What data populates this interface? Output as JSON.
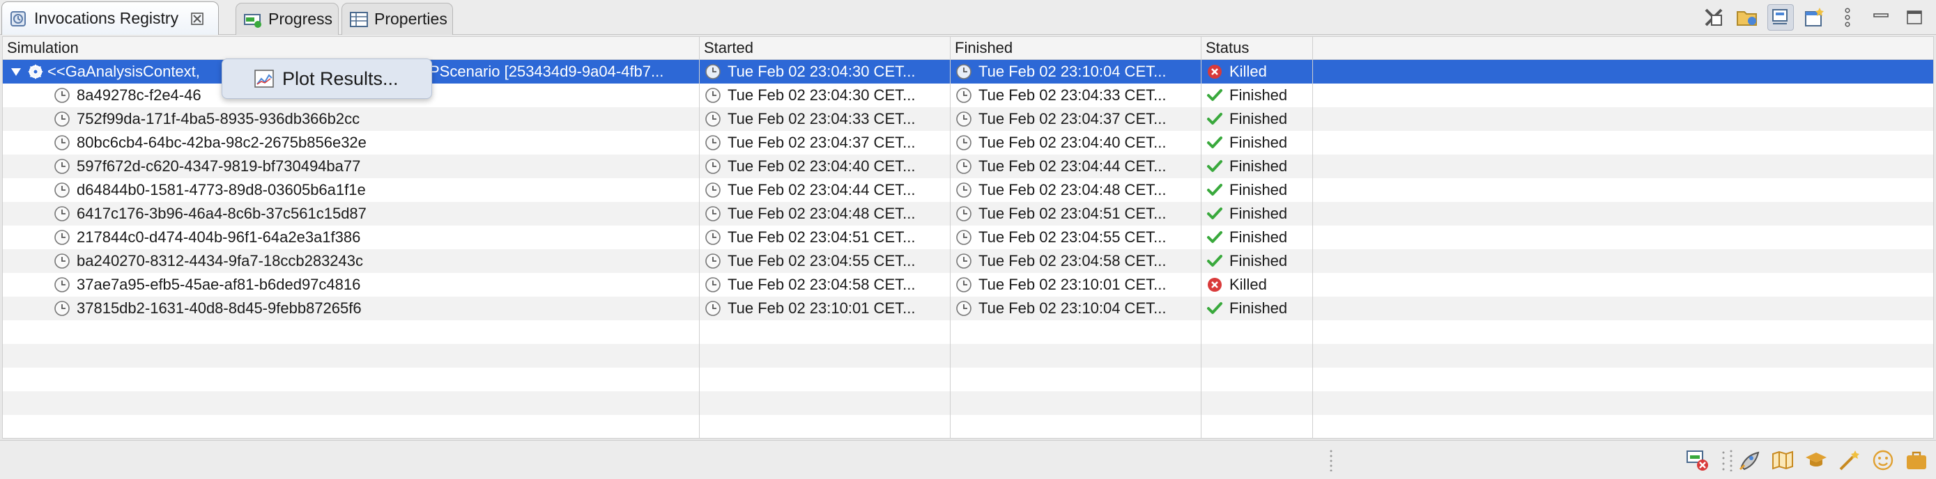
{
  "tabs": [
    {
      "label": "Invocations Registry",
      "icon": "registry-icon",
      "active": true,
      "closable": true
    },
    {
      "label": "Progress",
      "icon": "progress-icon",
      "active": false
    },
    {
      "label": "Properties",
      "icon": "properties-icon",
      "active": false
    }
  ],
  "view_toolbar": {
    "icons": [
      "remove-terminated-icon",
      "open-folder-icon",
      "toggle-view-icon",
      "new-window-icon",
      "view-menu-icon",
      "minimize-icon",
      "maximize-icon"
    ]
  },
  "table": {
    "columns": [
      "Simulation",
      "Started",
      "Finished",
      "Status"
    ],
    "rows": [
      {
        "name": "<<GaAnalysisContext, ",
        "name_tail": "PScenario [253434d9-9a04-4fb7...",
        "started": "Tue Feb 02 23:04:30 CET...",
        "finished": "Tue Feb 02 23:10:04 CET...",
        "status": "Killed",
        "parent": true,
        "selected": true
      },
      {
        "name": "8a49278c-f2e4-46",
        "started": "Tue Feb 02 23:04:30 CET...",
        "finished": "Tue Feb 02 23:04:33 CET...",
        "status": "Finished"
      },
      {
        "name": "752f99da-171f-4ba5-8935-936db366b2cc",
        "started": "Tue Feb 02 23:04:33 CET...",
        "finished": "Tue Feb 02 23:04:37 CET...",
        "status": "Finished"
      },
      {
        "name": "80bc6cb4-64bc-42ba-98c2-2675b856e32e",
        "started": "Tue Feb 02 23:04:37 CET...",
        "finished": "Tue Feb 02 23:04:40 CET...",
        "status": "Finished"
      },
      {
        "name": "597f672d-c620-4347-9819-bf730494ba77",
        "started": "Tue Feb 02 23:04:40 CET...",
        "finished": "Tue Feb 02 23:04:44 CET...",
        "status": "Finished"
      },
      {
        "name": "d64844b0-1581-4773-89d8-03605b6a1f1e",
        "started": "Tue Feb 02 23:04:44 CET...",
        "finished": "Tue Feb 02 23:04:48 CET...",
        "status": "Finished"
      },
      {
        "name": "6417c176-3b96-46a4-8c6b-37c561c15d87",
        "started": "Tue Feb 02 23:04:48 CET...",
        "finished": "Tue Feb 02 23:04:51 CET...",
        "status": "Finished"
      },
      {
        "name": "217844c0-d474-404b-96f1-64a2e3a1f386",
        "started": "Tue Feb 02 23:04:51 CET...",
        "finished": "Tue Feb 02 23:04:55 CET...",
        "status": "Finished"
      },
      {
        "name": "ba240270-8312-4434-9fa7-18ccb283243c",
        "started": "Tue Feb 02 23:04:55 CET...",
        "finished": "Tue Feb 02 23:04:58 CET...",
        "status": "Finished"
      },
      {
        "name": "37ae7a95-efb5-45ae-af81-b6ded97c4816",
        "started": "Tue Feb 02 23:04:58 CET...",
        "finished": "Tue Feb 02 23:10:01 CET...",
        "status": "Killed"
      },
      {
        "name": "37815db2-1631-40d8-8d45-9febb87265f6",
        "started": "Tue Feb 02 23:10:01 CET...",
        "finished": "Tue Feb 02 23:10:04 CET...",
        "status": "Finished"
      }
    ]
  },
  "context_menu": {
    "items": [
      {
        "label": "Plot Results...",
        "icon": "chart-icon"
      }
    ]
  },
  "status_bar": {
    "icons": [
      "cancel-jobs-icon",
      "rocket-icon",
      "map-icon",
      "graduation-cap-icon",
      "magic-wand-icon",
      "face-icon",
      "briefcase-icon"
    ]
  },
  "colors": {
    "selection": "#2d68d6",
    "killed": "#d93a3a",
    "finished": "#39a93c"
  }
}
